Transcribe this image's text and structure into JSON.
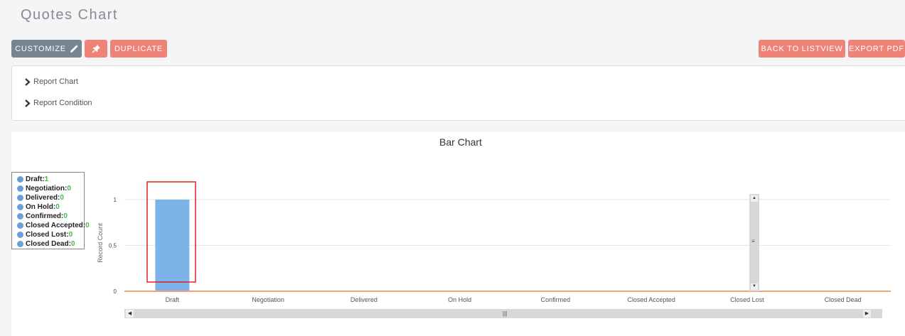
{
  "page": {
    "title": "Quotes Chart"
  },
  "toolbar": {
    "customize_label": "CUSTOMIZE",
    "duplicate_label": "DUPLICATE",
    "back_label": "BACK TO LISTVIEW",
    "export_label": "EXPORT PDF"
  },
  "panel": {
    "items": [
      {
        "label": "Report Chart"
      },
      {
        "label": "Report Condition"
      }
    ]
  },
  "legend": {
    "items": [
      {
        "label": "Draft:",
        "value": "1"
      },
      {
        "label": "Negotiation:",
        "value": "0"
      },
      {
        "label": "Delivered:",
        "value": "0"
      },
      {
        "label": "On Hold:",
        "value": "0"
      },
      {
        "label": "Confirmed:",
        "value": "0"
      },
      {
        "label": "Closed Accepted:",
        "value": "0"
      },
      {
        "label": "Closed Lost:",
        "value": "0"
      },
      {
        "label": "Closed Dead:",
        "value": "0"
      }
    ]
  },
  "colors": {
    "bar": "#7cb4ea",
    "baseline": "#f4a07c",
    "highlight": "#e02020",
    "legend_value": "#4ab84a"
  },
  "chart_data": {
    "type": "bar",
    "title": "Bar Chart",
    "categories": [
      "Draft",
      "Negotiation",
      "Delivered",
      "On Hold",
      "Confirmed",
      "Closed Accepted",
      "Closed Lost",
      "Closed Dead"
    ],
    "values": [
      1,
      0,
      0,
      0,
      0,
      0,
      0,
      0
    ],
    "xlabel": "",
    "ylabel": "Record Count",
    "ylim": [
      0,
      1
    ],
    "yticks": [
      "0",
      "0.5",
      "1"
    ],
    "grid": true,
    "legend_position": "left"
  }
}
